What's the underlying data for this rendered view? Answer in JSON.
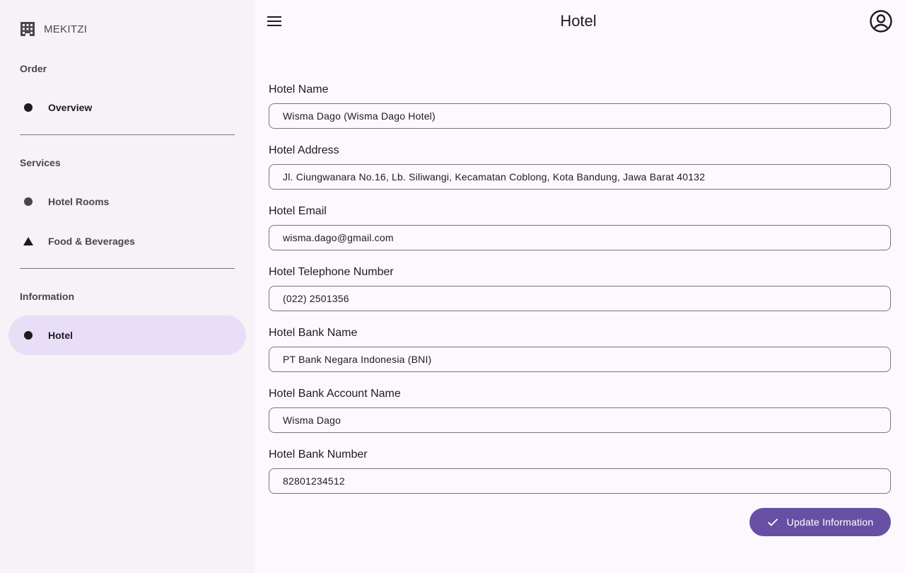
{
  "sidebar": {
    "brand": {
      "name": "MEKITZI",
      "icon": "hotel-building-icon"
    },
    "sections": [
      {
        "label": "Order"
      },
      {
        "label": "Services"
      },
      {
        "label": "Information"
      }
    ],
    "items": [
      {
        "label": "Overview",
        "icon": "circle-icon"
      },
      {
        "label": "Hotel Rooms",
        "icon": "circle-icon"
      },
      {
        "label": "Food & Beverages",
        "icon": "triangle-icon"
      },
      {
        "label": "Hotel",
        "icon": "circle-icon",
        "active": true
      }
    ]
  },
  "header": {
    "title": "Hotel",
    "menu_icon": "menu-icon",
    "account_icon": "account-circle-icon"
  },
  "form": {
    "fields": [
      {
        "label": "Hotel Name",
        "value": "Wisma Dago (Wisma Dago Hotel)"
      },
      {
        "label": "Hotel Address",
        "value": "Jl. Ciungwanara No.16, Lb. Siliwangi, Kecamatan Coblong, Kota Bandung, Jawa Barat 40132"
      },
      {
        "label": "Hotel Email",
        "value": "wisma.dago@gmail.com"
      },
      {
        "label": "Hotel Telephone Number",
        "value": "(022) 2501356"
      },
      {
        "label": "Hotel Bank Name",
        "value": "PT Bank Negara Indonesia (BNI)"
      },
      {
        "label": "Hotel Bank Account Name",
        "value": "Wisma Dago"
      },
      {
        "label": "Hotel Bank Number",
        "value": "82801234512"
      }
    ],
    "submit_label": "Update Information"
  },
  "colors": {
    "primary": "#6750a4",
    "active_nav": "#e8def8",
    "sidebar_bg": "#f7f2f7",
    "page_bg": "#fdf8fd"
  }
}
